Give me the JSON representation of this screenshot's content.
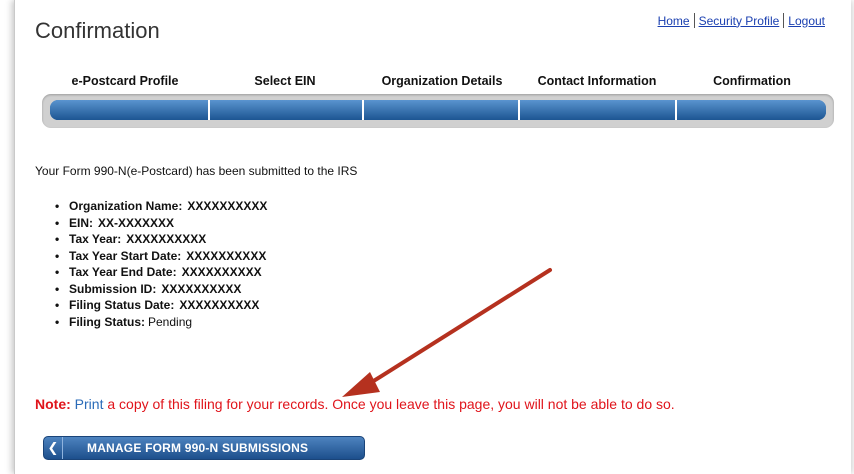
{
  "header": {
    "title": "Confirmation",
    "links": [
      "Home",
      "Security Profile",
      "Logout"
    ]
  },
  "steps": [
    "e-Postcard Profile",
    "Select EIN",
    "Organization Details",
    "Contact Information",
    "Confirmation"
  ],
  "message": "Your Form 990-N(e-Postcard) has been submitted to the IRS",
  "details": [
    {
      "label": "Organization Name:",
      "value": "XXXXXXXXXX",
      "bold_value": true
    },
    {
      "label": "EIN:",
      "value": "XX-XXXXXXX",
      "bold_value": true
    },
    {
      "label": "Tax Year:",
      "value": "XXXXXXXXXX",
      "bold_value": true
    },
    {
      "label": "Tax Year Start Date:",
      "value": "XXXXXXXXXX",
      "bold_value": true
    },
    {
      "label": "Tax Year End Date:",
      "value": "XXXXXXXXXX",
      "bold_value": true
    },
    {
      "label": "Submission ID:",
      "value": "XXXXXXXXXX",
      "bold_value": true
    },
    {
      "label": "Filing Status Date:",
      "value": "XXXXXXXXXX",
      "bold_value": true
    },
    {
      "label": "Filing Status:",
      "value": "Pending",
      "bold_value": false
    }
  ],
  "note": {
    "label": "Note:",
    "print_link": "Print",
    "text": "a copy of this filing for your records. Once you leave this page, you will not be able to do so."
  },
  "manage_button": {
    "icon": "chevron-left-icon",
    "label": "MANAGE FORM 990-N SUBMISSIONS"
  },
  "colors": {
    "link": "#1a3fb0",
    "note_red": "#e0141b",
    "progress_blue": "#1f5a98",
    "arrow": "#b5311f"
  }
}
